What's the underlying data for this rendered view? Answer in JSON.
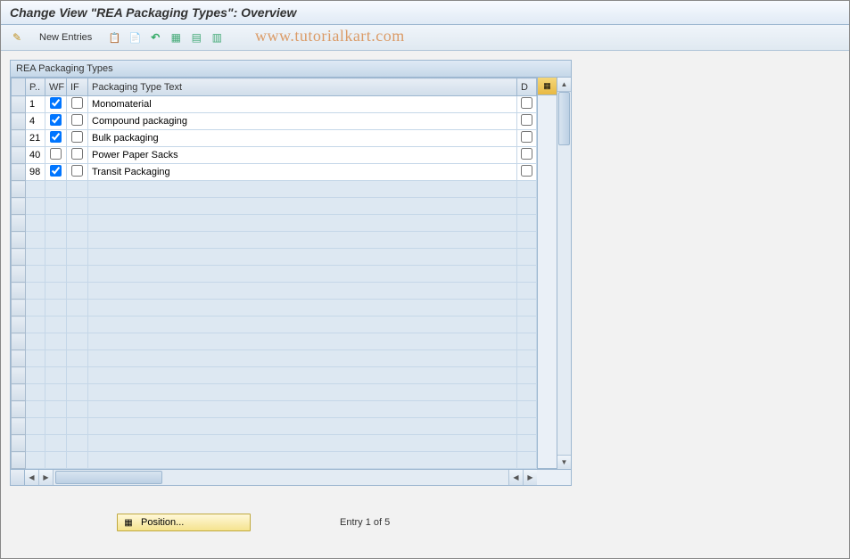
{
  "title": "Change View \"REA Packaging Types\": Overview",
  "watermark": "www.tutorialkart.com",
  "toolbar": {
    "new_entries_label": "New Entries"
  },
  "panel": {
    "title": "REA Packaging Types"
  },
  "columns": {
    "p": "P..",
    "wf": "WF",
    "if": "IF",
    "text": "Packaging Type Text",
    "d": "D"
  },
  "rows": [
    {
      "p": "1",
      "wf": true,
      "if": false,
      "text": "Monomaterial",
      "d": false
    },
    {
      "p": "4",
      "wf": true,
      "if": false,
      "text": "Compound packaging",
      "d": false
    },
    {
      "p": "21",
      "wf": true,
      "if": false,
      "text": "Bulk packaging",
      "d": false
    },
    {
      "p": "40",
      "wf": false,
      "if": false,
      "text": "Power Paper Sacks",
      "d": false
    },
    {
      "p": "98",
      "wf": true,
      "if": false,
      "text": "Transit Packaging",
      "d": false
    }
  ],
  "empty_rows": 17,
  "footer": {
    "position_label": "Position...",
    "entry_status": "Entry 1 of 5"
  }
}
